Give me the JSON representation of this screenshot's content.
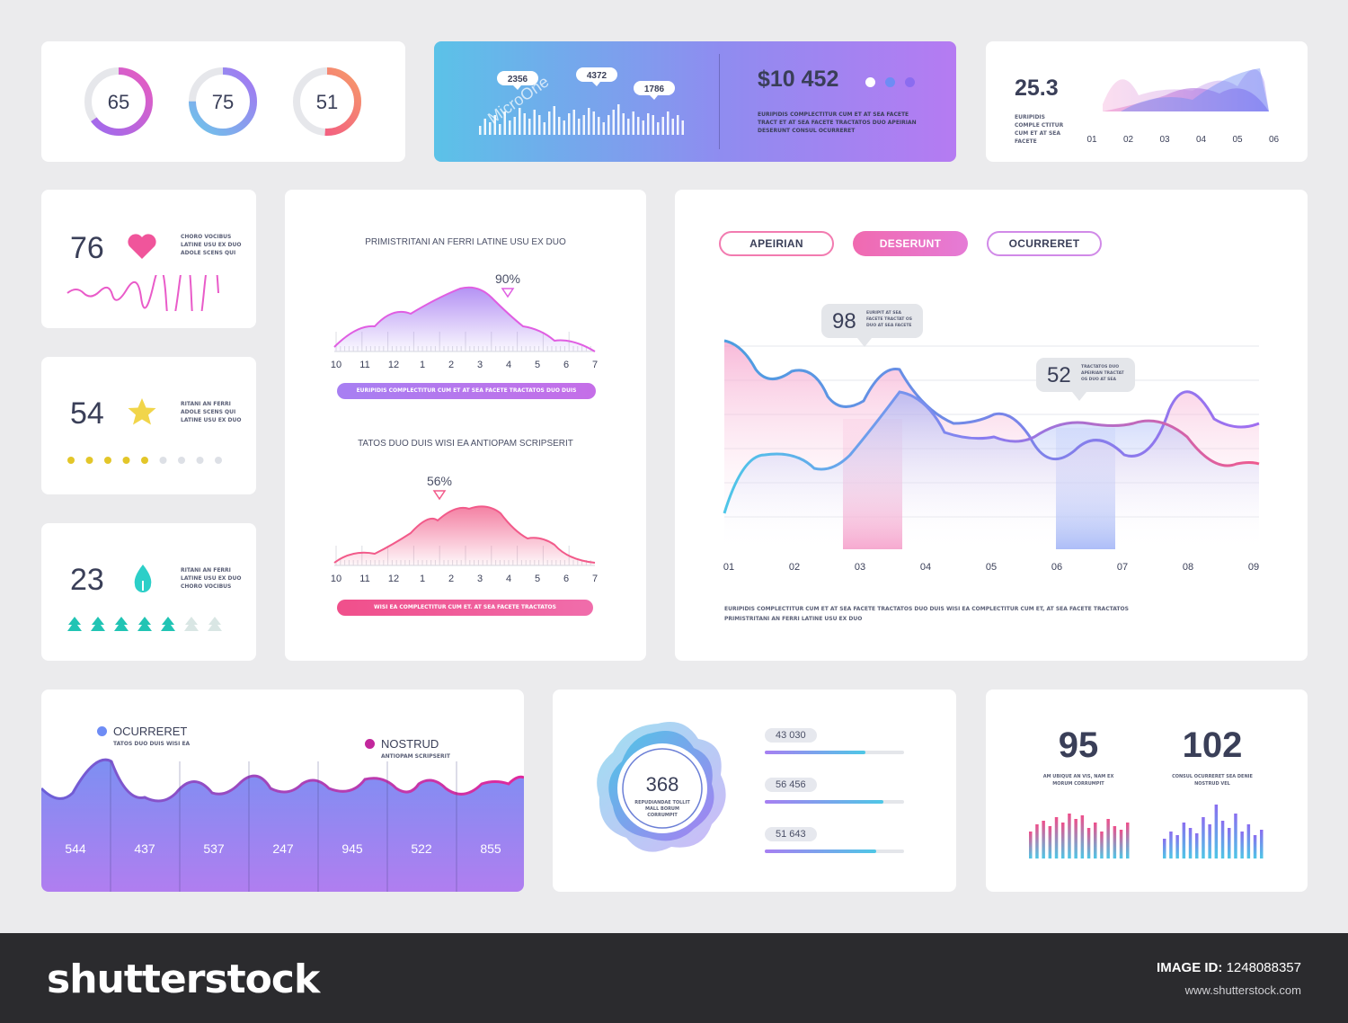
{
  "gauges": [
    {
      "value": "65",
      "percent": 65,
      "color_start": "#9b6cf0",
      "color_end": "#e85bc0"
    },
    {
      "value": "75",
      "percent": 75,
      "color_start": "#6ec6ea",
      "color_end": "#a574f2"
    },
    {
      "value": "51",
      "percent": 51,
      "color_start": "#f24f86",
      "color_end": "#f69a6a"
    }
  ],
  "hero": {
    "amount": "$10 452",
    "bubbles": [
      "2356",
      "4372",
      "1786"
    ],
    "watermark": "MicroOne",
    "text": "EURIPIDIS COMPLECTITUR CUM ET AT SEA FACETE TRACT ET AT SEA FACETE TRACTATOS DUO APEIRIAN DESERUNT CONSUL OCURRERET",
    "dots": [
      "#ffffff",
      "#6e8cf5",
      "#8b6cf0"
    ]
  },
  "wave_card": {
    "value": "25.3",
    "text": "EURIPIDIS COMPLE CTITUR CUM ET AT SEA FACETE",
    "x_labels": [
      "01",
      "02",
      "03",
      "04",
      "05",
      "06"
    ]
  },
  "stats": [
    {
      "value": "76",
      "icon": "heart-icon",
      "text": "CHORO VOCIBUS LATINE USU EX DUO ADOLE SCENS QUI"
    },
    {
      "value": "54",
      "icon": "star-icon",
      "text": "RITANI AN FERRI ADOLE SCENS QUI LATINE USU EX DUO",
      "dots_filled": 5,
      "dots_total": 9
    },
    {
      "value": "23",
      "icon": "drop-icon",
      "text": "RITANI AN FERRI LATINE USU EX DUO CHORO VOCIBUS",
      "trees_filled": 5,
      "trees_total": 7
    }
  ],
  "mid_charts": {
    "top": {
      "title": "PRIMISTRITANI AN FERRI LATINE USU EX DUO",
      "peak": "90%",
      "x_labels": [
        "10",
        "11",
        "12",
        "1",
        "2",
        "3",
        "4",
        "5",
        "6",
        "7"
      ],
      "bar_text": "EURIPIDIS COMPLECTITUR CUM ET AT SEA FACETE TRACTATOS DUO DUIS"
    },
    "bottom": {
      "title": "TATOS DUO DUIS WISI EA ANTIOPAM SCRIPSERIT",
      "peak": "56%",
      "x_labels": [
        "10",
        "11",
        "12",
        "1",
        "2",
        "3",
        "4",
        "5",
        "6",
        "7"
      ],
      "bar_text": "WISI EA COMPLECTITUR CUM ET. AT SEA FACETE TRACTATOS"
    }
  },
  "big_chart": {
    "tabs": [
      "APEIRIAN",
      "DESERUNT",
      "OCURRERET"
    ],
    "active_tab": 1,
    "callouts": [
      {
        "value": "98",
        "text": "EURIPIT AT SEA FACETE TRACTAT OS DUO AT SEA FACETE TRACTATOS APEIRIAN"
      },
      {
        "value": "52",
        "text": "TRACTATOS DUO APEIRIAN TRACTAT OS DUO AT SEA FACETE TRACTATOS"
      }
    ],
    "x_labels": [
      "01",
      "02",
      "03",
      "04",
      "05",
      "06",
      "07",
      "08",
      "09"
    ],
    "footer_text_1": "EURIPIDIS COMPLECTITUR CUM ET AT SEA FACETE TRACTATOS DUO DUIS WISI EA COMPLECTITUR CUM ET, AT SEA FACETE TRACTATOS",
    "footer_text_2": "PRIMISTRITANI AN FERRI LATINE USU EX DUO"
  },
  "area_card": {
    "legend": [
      {
        "name": "OCURRERET",
        "sub": "TATOS DUO DUIS WISI EA",
        "color": "#6e8cf5"
      },
      {
        "name": "NOSTRUD",
        "sub": "ANTIOPAM SCRIPSERIT",
        "color": "#c2279c"
      }
    ],
    "values": [
      "544",
      "437",
      "537",
      "247",
      "945",
      "522",
      "855"
    ]
  },
  "blob_card": {
    "value": "368",
    "sub": "REPUDIANDAE TOLLIT MALL BORUM CORRUMPIT",
    "bars": [
      {
        "label": "43 030",
        "fill": 0.72
      },
      {
        "label": "56 456",
        "fill": 0.85
      },
      {
        "label": "51 643",
        "fill": 0.8
      }
    ]
  },
  "kpi_card": {
    "items": [
      {
        "value": "95",
        "text": "AM UBIQUE AN VIS, NAM EX MORUM CORRUMPIT"
      },
      {
        "value": "102",
        "text": "CONSUL OCURRERET SEA DENIE NOSTRUD VEL"
      }
    ]
  },
  "footer": {
    "brand": "shutterstock",
    "image_id_label": "IMAGE ID:",
    "image_id": "1248088357",
    "url": "www.shutterstock.com"
  }
}
